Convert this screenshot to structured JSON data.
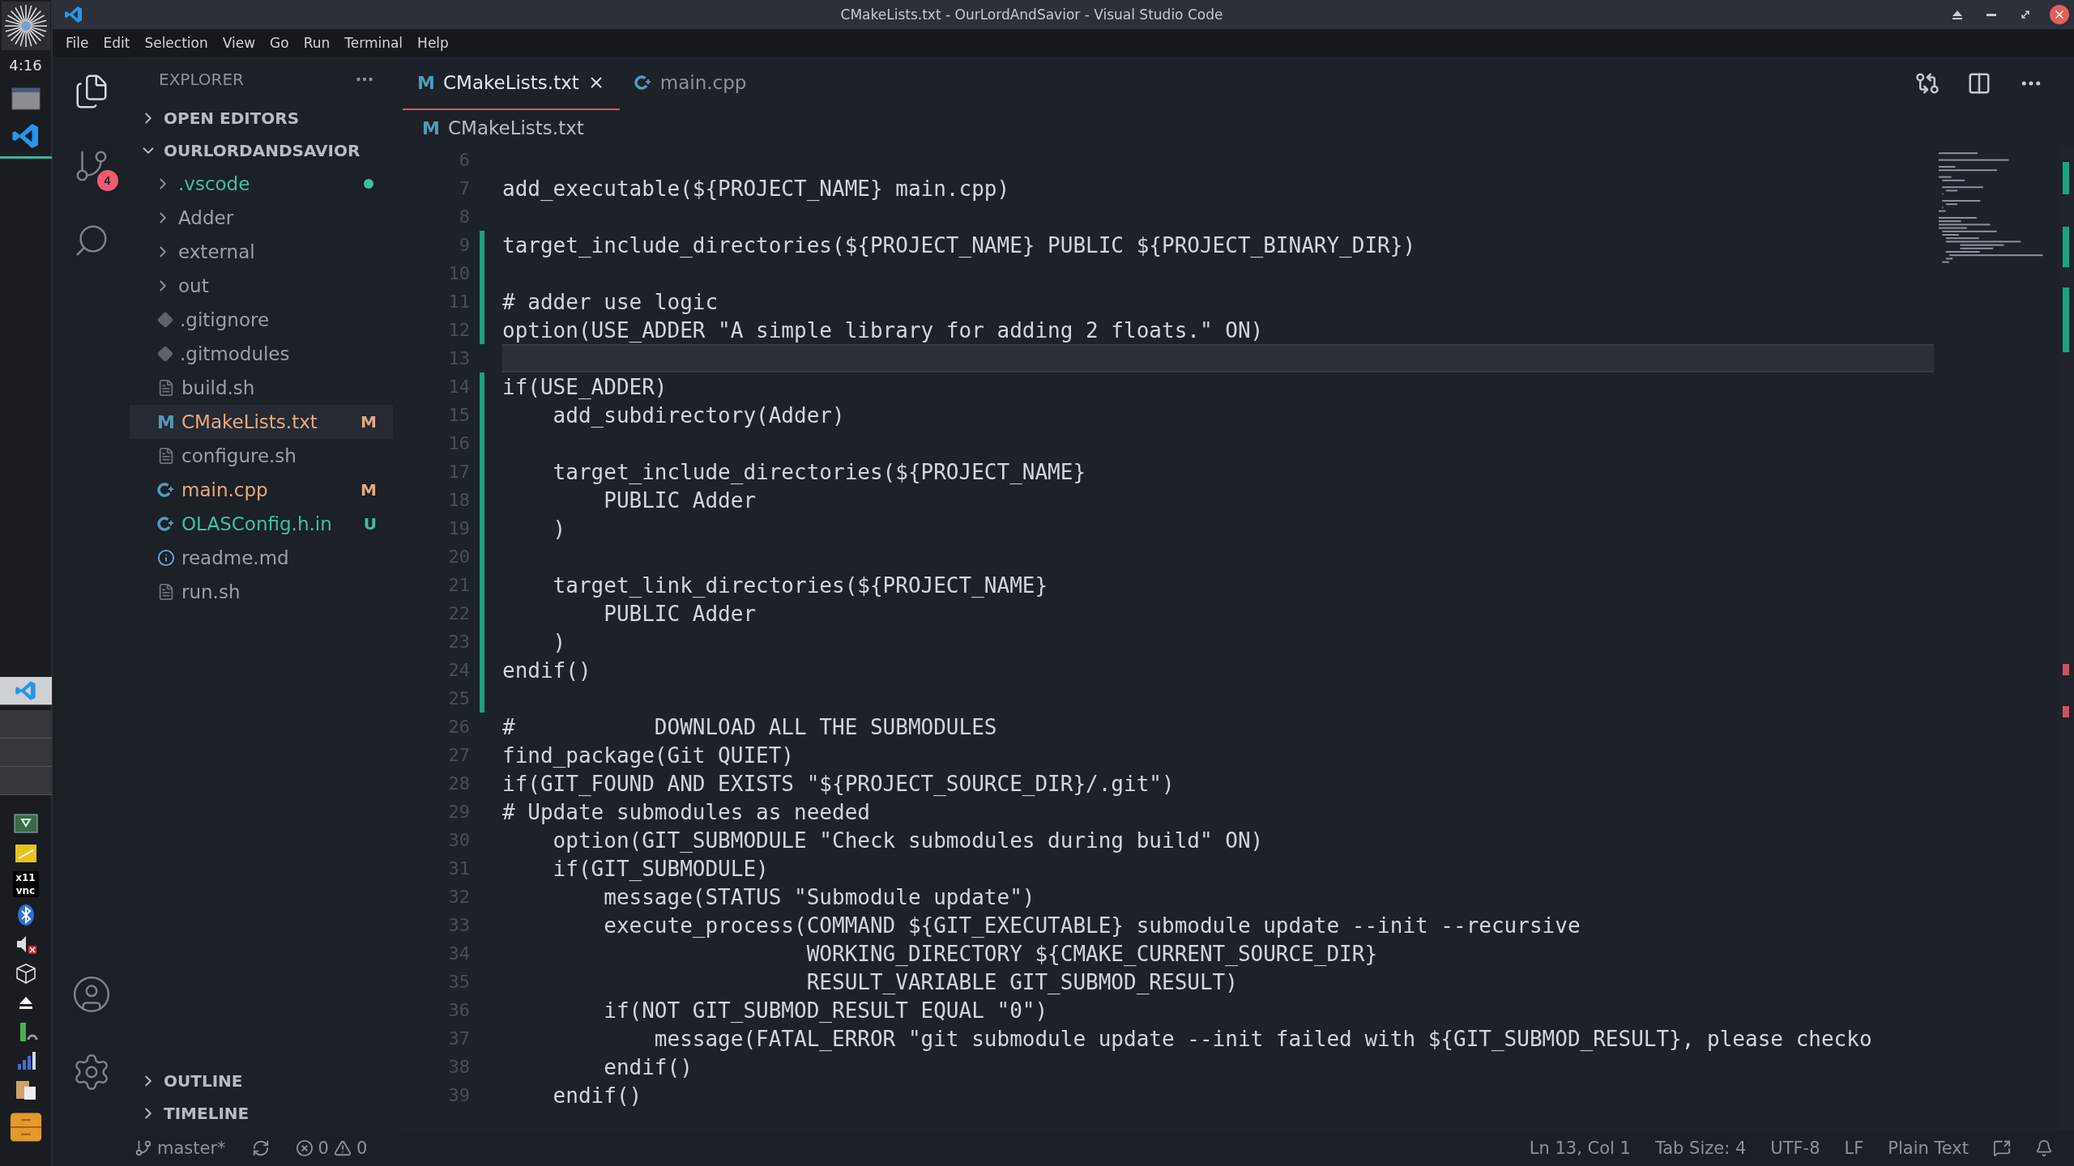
{
  "desktop": {
    "clock": "4:16",
    "tray_label": "x11 vnc"
  },
  "window": {
    "title": "CMakeLists.txt - OurLordAndSavior - Visual Studio Code"
  },
  "menu": [
    "File",
    "Edit",
    "Selection",
    "View",
    "Go",
    "Run",
    "Terminal",
    "Help"
  ],
  "activity_bar": {
    "scm_badge": "4"
  },
  "sidebar": {
    "title": "EXPLORER",
    "sections": [
      {
        "title": "OPEN EDITORS",
        "expanded": false
      },
      {
        "title": "OURLORDANDSAVIOR",
        "expanded": true,
        "children": [
          {
            "name": ".vscode",
            "kind": "folder",
            "color": "#3ec29c",
            "dot": true,
            "selected": false
          },
          {
            "name": "Adder",
            "kind": "folder",
            "color": "#9aa0a8",
            "selected": false
          },
          {
            "name": "external",
            "kind": "folder",
            "color": "#9aa0a8",
            "selected": false
          },
          {
            "name": "out",
            "kind": "folder",
            "color": "#9aa0a8",
            "selected": false
          },
          {
            "name": ".gitignore",
            "kind": "git",
            "color": "#9aa0a8",
            "selected": false
          },
          {
            "name": ".gitmodules",
            "kind": "git",
            "color": "#9aa0a8",
            "selected": false
          },
          {
            "name": "build.sh",
            "kind": "file",
            "color": "#9aa0a8",
            "selected": false
          },
          {
            "name": "CMakeLists.txt",
            "kind": "cmake",
            "icon": "M",
            "color": "#e5a97f",
            "status": "M",
            "selected": true
          },
          {
            "name": "configure.sh",
            "kind": "file",
            "color": "#9aa0a8",
            "selected": false
          },
          {
            "name": "main.cpp",
            "kind": "cpp",
            "color": "#e5a97f",
            "status": "M",
            "selected": false
          },
          {
            "name": "OLASConfig.h.in",
            "kind": "cpp",
            "color": "#3ec29c",
            "status": "U",
            "selected": false
          },
          {
            "name": "readme.md",
            "kind": "info",
            "color": "#9aa0a8",
            "selected": false
          },
          {
            "name": "run.sh",
            "kind": "file",
            "color": "#9aa0a8",
            "selected": false
          }
        ]
      }
    ],
    "bottom_sections": [
      {
        "title": "OUTLINE",
        "expanded": false
      },
      {
        "title": "TIMELINE",
        "expanded": false
      }
    ]
  },
  "tabs": [
    {
      "label": "CMakeLists.txt",
      "kind": "cmake",
      "icon": "M",
      "selected": true
    },
    {
      "label": "main.cpp",
      "kind": "cpp",
      "selected": false
    }
  ],
  "breadcrumb": {
    "label": "CMakeLists.txt",
    "kind": "cmake",
    "icon": "M"
  },
  "editor": {
    "lines": [
      {
        "n": "6",
        "changed": false,
        "current": false
      },
      {
        "n": "7",
        "text": "add_executable(${PROJECT_NAME} main.cpp)",
        "changed": false,
        "current": false
      },
      {
        "n": "8",
        "changed": false,
        "current": false
      },
      {
        "n": "9",
        "text": "target_include_directories(${PROJECT_NAME} PUBLIC ${PROJECT_BINARY_DIR})",
        "changed": true,
        "current": false
      },
      {
        "n": "10",
        "changed": true,
        "current": false
      },
      {
        "n": "11",
        "text": "# adder use logic",
        "changed": true,
        "current": false
      },
      {
        "n": "12",
        "text": "option(USE_ADDER \"A simple library for adding 2 floats.\" ON)",
        "changed": true,
        "current": false
      },
      {
        "n": "13",
        "changed": false,
        "current": true
      },
      {
        "n": "14",
        "text": "if(USE_ADDER)",
        "changed": true,
        "current": false
      },
      {
        "n": "15",
        "text": "    add_subdirectory(Adder)",
        "changed": true,
        "current": false
      },
      {
        "n": "16",
        "changed": true,
        "current": false
      },
      {
        "n": "17",
        "text": "    target_include_directories(${PROJECT_NAME}",
        "changed": true,
        "current": false
      },
      {
        "n": "18",
        "text": "        PUBLIC Adder",
        "changed": true,
        "current": false
      },
      {
        "n": "19",
        "text": "    )",
        "changed": true,
        "current": false
      },
      {
        "n": "20",
        "changed": true,
        "current": false
      },
      {
        "n": "21",
        "text": "    target_link_directories(${PROJECT_NAME}",
        "changed": true,
        "current": false
      },
      {
        "n": "22",
        "text": "        PUBLIC Adder",
        "changed": true,
        "current": false
      },
      {
        "n": "23",
        "text": "    )",
        "changed": true,
        "current": false
      },
      {
        "n": "24",
        "text": "endif()",
        "changed": true,
        "current": false
      },
      {
        "n": "25",
        "changed": true,
        "current": false
      },
      {
        "n": "26",
        "text": "#           DOWNLOAD ALL THE SUBMODULES",
        "changed": false,
        "current": false
      },
      {
        "n": "27",
        "text": "find_package(Git QUIET)",
        "changed": false,
        "current": false
      },
      {
        "n": "28",
        "text": "if(GIT_FOUND AND EXISTS \"${PROJECT_SOURCE_DIR}/.git\")",
        "changed": false,
        "current": false
      },
      {
        "n": "29",
        "text": "# Update submodules as needed",
        "changed": false,
        "current": false
      },
      {
        "n": "30",
        "text": "    option(GIT_SUBMODULE \"Check submodules during build\" ON)",
        "changed": false,
        "current": false
      },
      {
        "n": "31",
        "text": "    if(GIT_SUBMODULE)",
        "changed": false,
        "current": false
      },
      {
        "n": "32",
        "text": "        message(STATUS \"Submodule update\")",
        "changed": false,
        "current": false
      },
      {
        "n": "33",
        "text": "        execute_process(COMMAND ${GIT_EXECUTABLE} submodule update --init --recursive",
        "changed": false,
        "current": false
      },
      {
        "n": "34",
        "text": "                        WORKING_DIRECTORY ${CMAKE_CURRENT_SOURCE_DIR}",
        "changed": false,
        "current": false
      },
      {
        "n": "35",
        "text": "                        RESULT_VARIABLE GIT_SUBMOD_RESULT)",
        "changed": false,
        "current": false
      },
      {
        "n": "36",
        "text": "        if(NOT GIT_SUBMOD_RESULT EQUAL \"0\")",
        "changed": false,
        "current": false
      },
      {
        "n": "37",
        "text": "            message(FATAL_ERROR \"git submodule update --init failed with ${GIT_SUBMOD_RESULT}, please checko",
        "changed": false,
        "current": false
      },
      {
        "n": "38",
        "text": "        endif()",
        "changed": false,
        "current": false
      },
      {
        "n": "39",
        "text": "    endif()",
        "changed": false,
        "current": false
      }
    ]
  },
  "status_bar": {
    "branch": "master*",
    "errors": "0",
    "warnings": "0",
    "position": "Ln 13, Col 1",
    "tab_size": "Tab Size: 4",
    "encoding": "UTF-8",
    "eol": "LF",
    "language": "Plain Text"
  }
}
